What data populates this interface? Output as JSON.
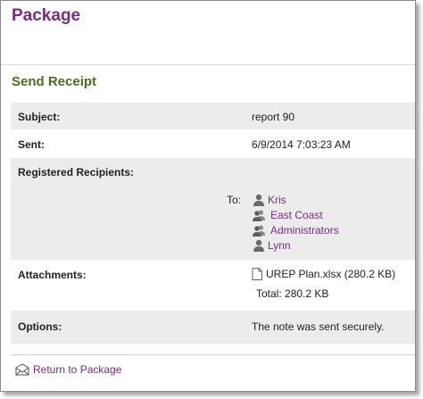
{
  "header": {
    "title": "Package"
  },
  "section": {
    "title": "Send Receipt"
  },
  "fields": {
    "subject": {
      "label": "Subject:",
      "value": "report 90"
    },
    "sent": {
      "label": "Sent:",
      "value": "6/9/2014 7:03:23 AM"
    },
    "recipients": {
      "label": "Registered Recipients:",
      "to_label": "To:",
      "list": [
        {
          "name": "Kris",
          "icon": "user-icon"
        },
        {
          "name": "East Coast",
          "icon": "group-icon"
        },
        {
          "name": "Administrators",
          "icon": "group-icon"
        },
        {
          "name": "Lynn",
          "icon": "user-icon"
        }
      ]
    },
    "attachments": {
      "label": "Attachments:",
      "file": "UREP Plan.xlsx (280.2 KB)",
      "total": "Total: 280.2 KB"
    },
    "options": {
      "label": "Options:",
      "value": "The note was sent securely."
    }
  },
  "footer": {
    "return_link": "Return to Package"
  },
  "colors": {
    "title": "#7b2a85",
    "section": "#4f6b1c",
    "link": "#7b2a85",
    "row_shade": "#ececec"
  }
}
